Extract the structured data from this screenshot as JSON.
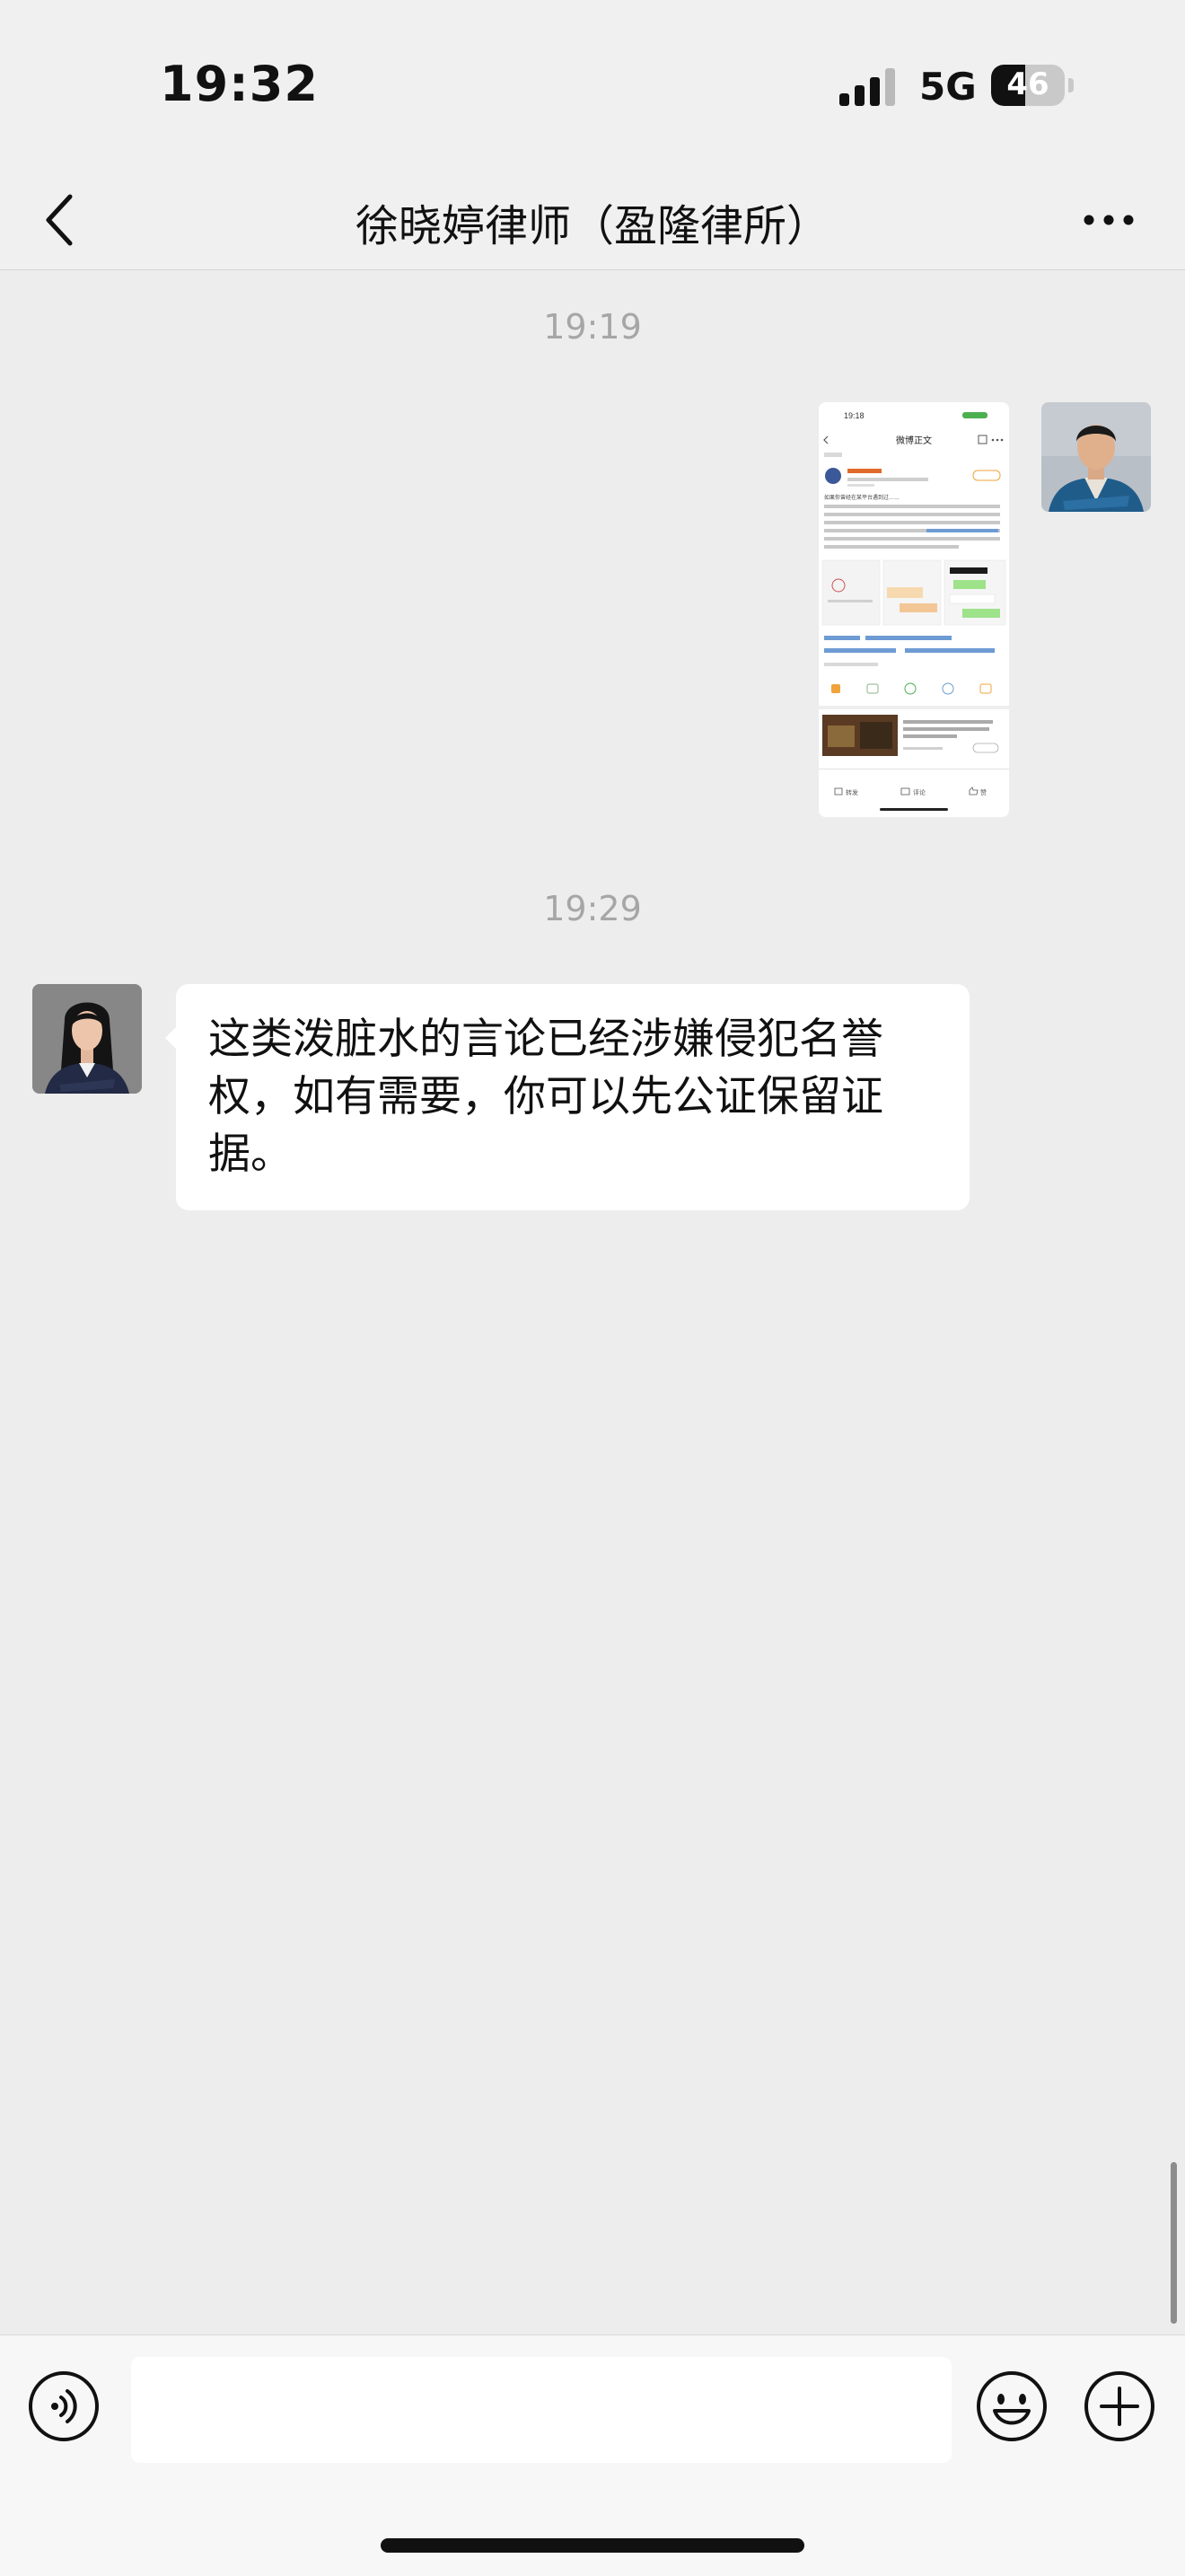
{
  "status_bar": {
    "time": "19:32",
    "network": "5G",
    "battery": "46",
    "battery_level": 0.46
  },
  "nav": {
    "title": "徐晓婷律师（盈隆律所）",
    "back_icon": "chevron-left-icon",
    "more_icon": "more-horizontal-icon"
  },
  "chat": {
    "messages": [
      {
        "timestamp": "19:19",
        "sender": "me",
        "type": "image",
        "thumbnail": {
          "status_time": "19:18",
          "header_title": "微博正文",
          "post_text": "如果你曾经在某平台遇到过……",
          "action_share": "转发",
          "action_comment": "评论",
          "action_like": "赞"
        }
      },
      {
        "timestamp": "19:29",
        "sender": "lawyer",
        "type": "text",
        "text": "这类泼脏水的言论已经涉嫌侵犯名誉权，如有需要，你可以先公证保留证据。"
      }
    ]
  },
  "input_bar": {
    "placeholder": "",
    "voice_icon": "voice-icon",
    "emoji_icon": "emoji-icon",
    "plus_icon": "plus-icon"
  },
  "colors": {
    "chat_background": "#ededed",
    "bubble_background": "#ffffff",
    "timestamp": "#a6a6a6"
  }
}
